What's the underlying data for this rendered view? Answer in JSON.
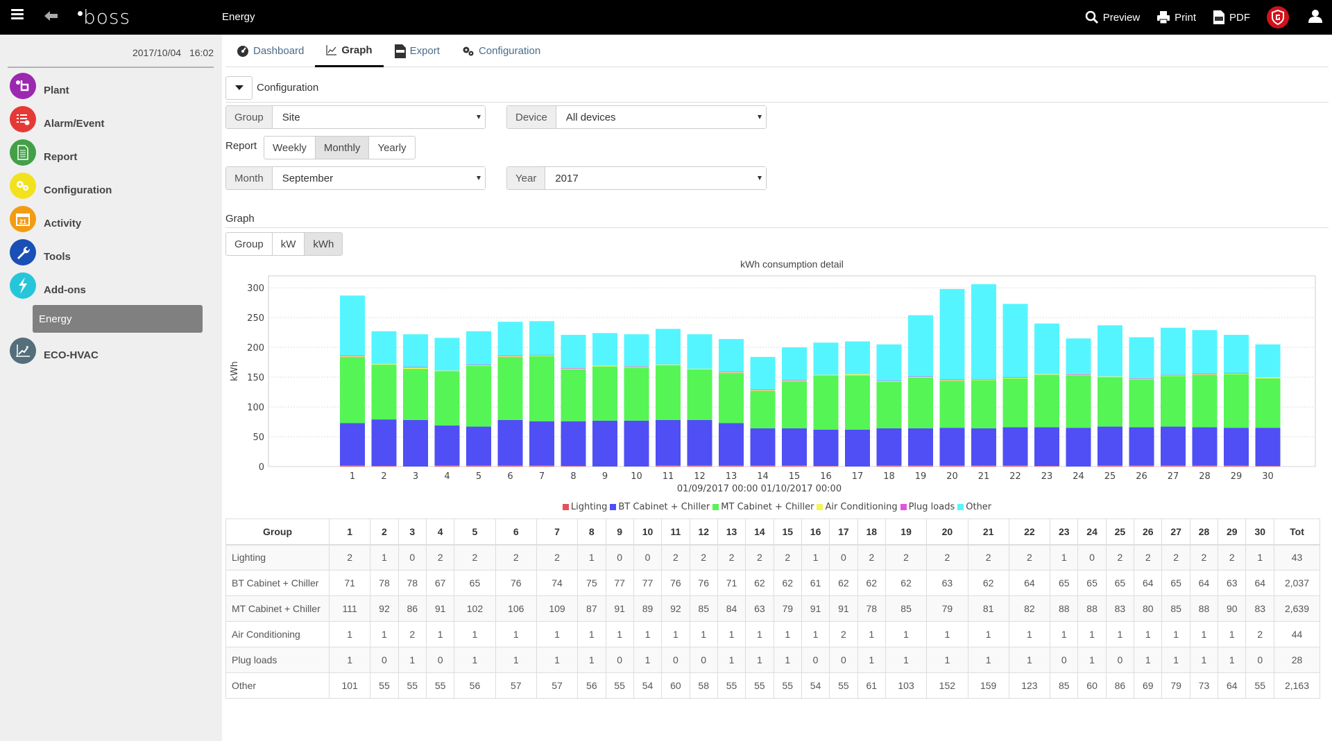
{
  "topbar": {
    "title": "Energy",
    "logo": "boss",
    "preview_label": "Preview",
    "print_label": "Print",
    "pdf_label": "PDF"
  },
  "sidebar": {
    "date": "2017/10/04",
    "time": "16:02",
    "items": [
      {
        "label": "Plant",
        "icon": "plant-icon",
        "color": "#9c27b0"
      },
      {
        "label": "Alarm/Event",
        "icon": "alarm-list-icon",
        "color": "#e53935"
      },
      {
        "label": "Report",
        "icon": "report-document-icon",
        "color": "#43a047"
      },
      {
        "label": "Configuration",
        "icon": "gears-icon",
        "color": "#f2e21e"
      },
      {
        "label": "Activity",
        "icon": "calendar-icon",
        "color": "#f39c12"
      },
      {
        "label": "Tools",
        "icon": "wrench-icon",
        "color": "#1a4fb5"
      },
      {
        "label": "Add-ons",
        "icon": "lightning-icon",
        "color": "#26c6da"
      },
      {
        "label": "ECO-HVAC",
        "icon": "trend-chart-icon",
        "color": "#546e7a"
      }
    ],
    "sub_item": "Energy"
  },
  "tabs": [
    {
      "label": "Dashboard",
      "icon": "dashboard-gauge-icon",
      "active": false
    },
    {
      "label": "Graph",
      "icon": "line-graph-icon",
      "active": true
    },
    {
      "label": "Export",
      "icon": "export-icon",
      "active": false
    },
    {
      "label": "Configuration",
      "icon": "gears-icon",
      "active": false
    }
  ],
  "config": {
    "title": "Configuration",
    "group_label": "Group",
    "group_value": "Site",
    "device_label": "Device",
    "device_value": "All devices",
    "report_label": "Report",
    "report_options": [
      "Weekly",
      "Monthly",
      "Yearly"
    ],
    "report_selected": "Monthly",
    "month_label": "Month",
    "month_value": "September",
    "year_label": "Year",
    "year_value": "2017"
  },
  "graph": {
    "title": "Graph",
    "modes": [
      "Group",
      "kW",
      "kWh"
    ],
    "mode_selected": "kWh"
  },
  "chart_data": {
    "type": "bar",
    "stacked": true,
    "title": "kWh consumption detail",
    "xlabel": "01/09/2017 00:00        01/10/2017 00:00",
    "ylabel": "kWh",
    "ylim": [
      0,
      320
    ],
    "yticks": [
      0,
      50,
      100,
      150,
      200,
      250,
      300
    ],
    "grid": true,
    "legend_position": "bottom",
    "categories": [
      "1",
      "2",
      "3",
      "4",
      "5",
      "6",
      "7",
      "8",
      "9",
      "10",
      "11",
      "12",
      "13",
      "14",
      "15",
      "16",
      "17",
      "18",
      "19",
      "20",
      "21",
      "22",
      "23",
      "24",
      "25",
      "26",
      "27",
      "28",
      "29",
      "30"
    ],
    "series": [
      {
        "name": "Lighting",
        "color": "#e8505b",
        "values": [
          2,
          1,
          0,
          2,
          2,
          2,
          2,
          1,
          0,
          0,
          2,
          2,
          2,
          2,
          2,
          1,
          0,
          2,
          2,
          2,
          2,
          2,
          1,
          0,
          2,
          2,
          2,
          2,
          2,
          1
        ]
      },
      {
        "name": "BT Cabinet + Chiller",
        "color": "#4f4ff5",
        "values": [
          71,
          78,
          78,
          67,
          65,
          76,
          74,
          75,
          77,
          77,
          76,
          76,
          71,
          62,
          62,
          61,
          62,
          62,
          62,
          63,
          62,
          64,
          65,
          65,
          65,
          64,
          65,
          64,
          63,
          64
        ]
      },
      {
        "name": "MT Cabinet + Chiller",
        "color": "#55f555",
        "values": [
          111,
          92,
          86,
          91,
          102,
          106,
          109,
          87,
          91,
          89,
          92,
          85,
          84,
          63,
          79,
          91,
          91,
          78,
          85,
          79,
          81,
          82,
          88,
          88,
          83,
          80,
          85,
          88,
          90,
          83
        ]
      },
      {
        "name": "Air Conditioning",
        "color": "#f5f555",
        "values": [
          1,
          1,
          2,
          1,
          1,
          1,
          1,
          1,
          1,
          1,
          1,
          1,
          1,
          1,
          1,
          1,
          2,
          1,
          1,
          1,
          1,
          1,
          1,
          1,
          1,
          1,
          1,
          1,
          1,
          2
        ]
      },
      {
        "name": "Plug loads",
        "color": "#e055e0",
        "values": [
          1,
          0,
          1,
          0,
          1,
          1,
          1,
          1,
          0,
          1,
          0,
          0,
          1,
          1,
          1,
          0,
          0,
          1,
          1,
          1,
          1,
          1,
          0,
          1,
          0,
          1,
          1,
          1,
          1,
          0
        ]
      },
      {
        "name": "Other",
        "color": "#55f5ff",
        "values": [
          101,
          55,
          55,
          55,
          56,
          57,
          57,
          56,
          55,
          54,
          60,
          58,
          55,
          55,
          55,
          54,
          55,
          61,
          103,
          152,
          159,
          123,
          85,
          60,
          86,
          69,
          79,
          73,
          64,
          55
        ]
      }
    ]
  },
  "table": {
    "group_header": "Group",
    "total_header": "Tot",
    "totals": [
      "43",
      "2,037",
      "2,639",
      "44",
      "28",
      "2,163"
    ]
  }
}
